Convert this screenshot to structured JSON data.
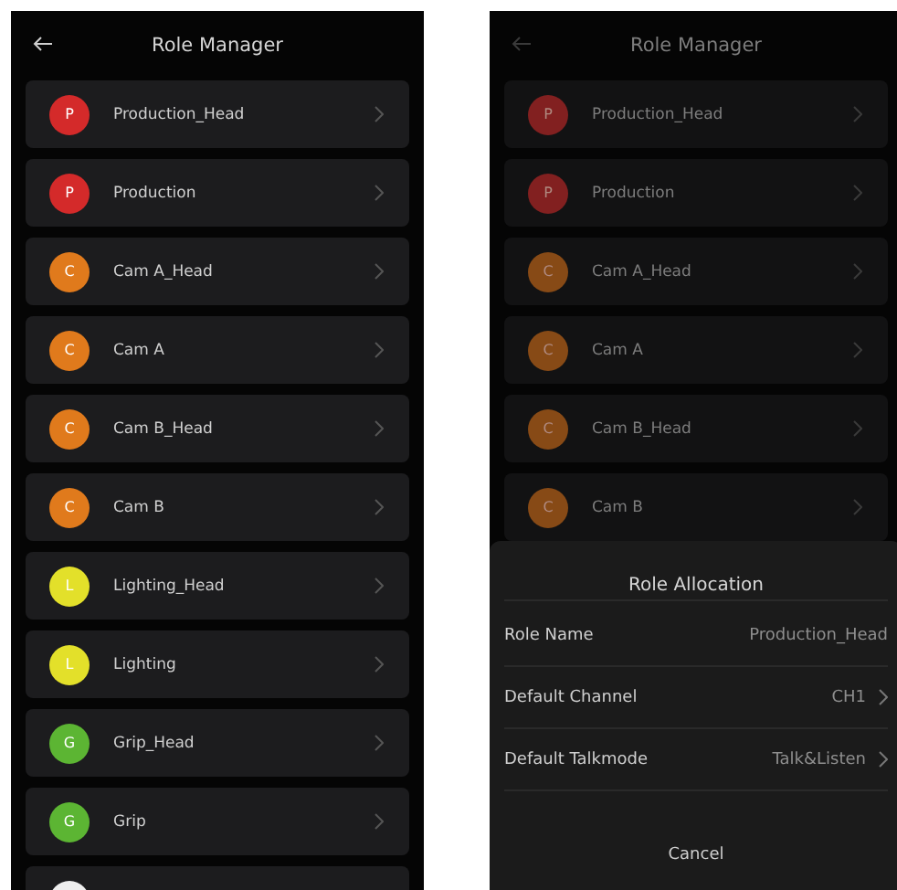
{
  "screens": [
    {
      "title": "Role Manager",
      "roles": [
        {
          "initial": "P",
          "name": "Production_Head",
          "color": "#d42a2a"
        },
        {
          "initial": "P",
          "name": "Production",
          "color": "#d42a2a"
        },
        {
          "initial": "C",
          "name": "Cam A_Head",
          "color": "#e07a1c"
        },
        {
          "initial": "C",
          "name": "Cam A",
          "color": "#e07a1c"
        },
        {
          "initial": "C",
          "name": "Cam B_Head",
          "color": "#e07a1c"
        },
        {
          "initial": "C",
          "name": "Cam B",
          "color": "#e07a1c"
        },
        {
          "initial": "L",
          "name": "Lighting_Head",
          "color": "#e3e02a"
        },
        {
          "initial": "L",
          "name": "Lighting",
          "color": "#e3e02a"
        },
        {
          "initial": "G",
          "name": "Grip_Head",
          "color": "#5cb533"
        },
        {
          "initial": "G",
          "name": "Grip",
          "color": "#5cb533"
        },
        {
          "color": "#eeeeee"
        }
      ]
    },
    {
      "title": "Role Manager",
      "roles": [
        {
          "initial": "P",
          "name": "Production_Head",
          "color": "#822020"
        },
        {
          "initial": "P",
          "name": "Production",
          "color": "#822020"
        },
        {
          "initial": "C",
          "name": "Cam A_Head",
          "color": "#874a16"
        },
        {
          "initial": "C",
          "name": "Cam A",
          "color": "#874a16"
        },
        {
          "initial": "C",
          "name": "Cam B_Head",
          "color": "#874a16"
        },
        {
          "initial": "C",
          "name": "Cam B",
          "color": "#874a16"
        }
      ],
      "sheet": {
        "title": "Role Allocation",
        "rows": [
          {
            "kind": "text",
            "label": "Role Name",
            "value": "Production_Head"
          },
          {
            "kind": "select",
            "label": "Default Channel",
            "value": "CH1"
          },
          {
            "kind": "select",
            "label": "Default Talkmode",
            "value": "Talk&Listen"
          }
        ],
        "cancel": "Cancel"
      }
    }
  ]
}
